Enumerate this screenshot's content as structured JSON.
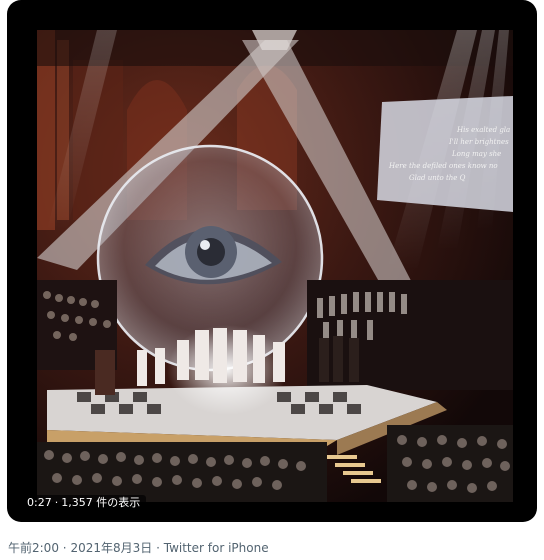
{
  "video": {
    "elapsed": "0:27",
    "views": "1,357 件の表示",
    "screen_text": [
      "His exalted gla",
      "I'll her brightnes",
      "Long may she",
      "Here the defiled ones know no",
      "Glad unto the Q"
    ]
  },
  "meta": {
    "time": "午前2:00",
    "separator": "·",
    "date": "2021年8月3日",
    "source": "Twitter for iPhone"
  }
}
